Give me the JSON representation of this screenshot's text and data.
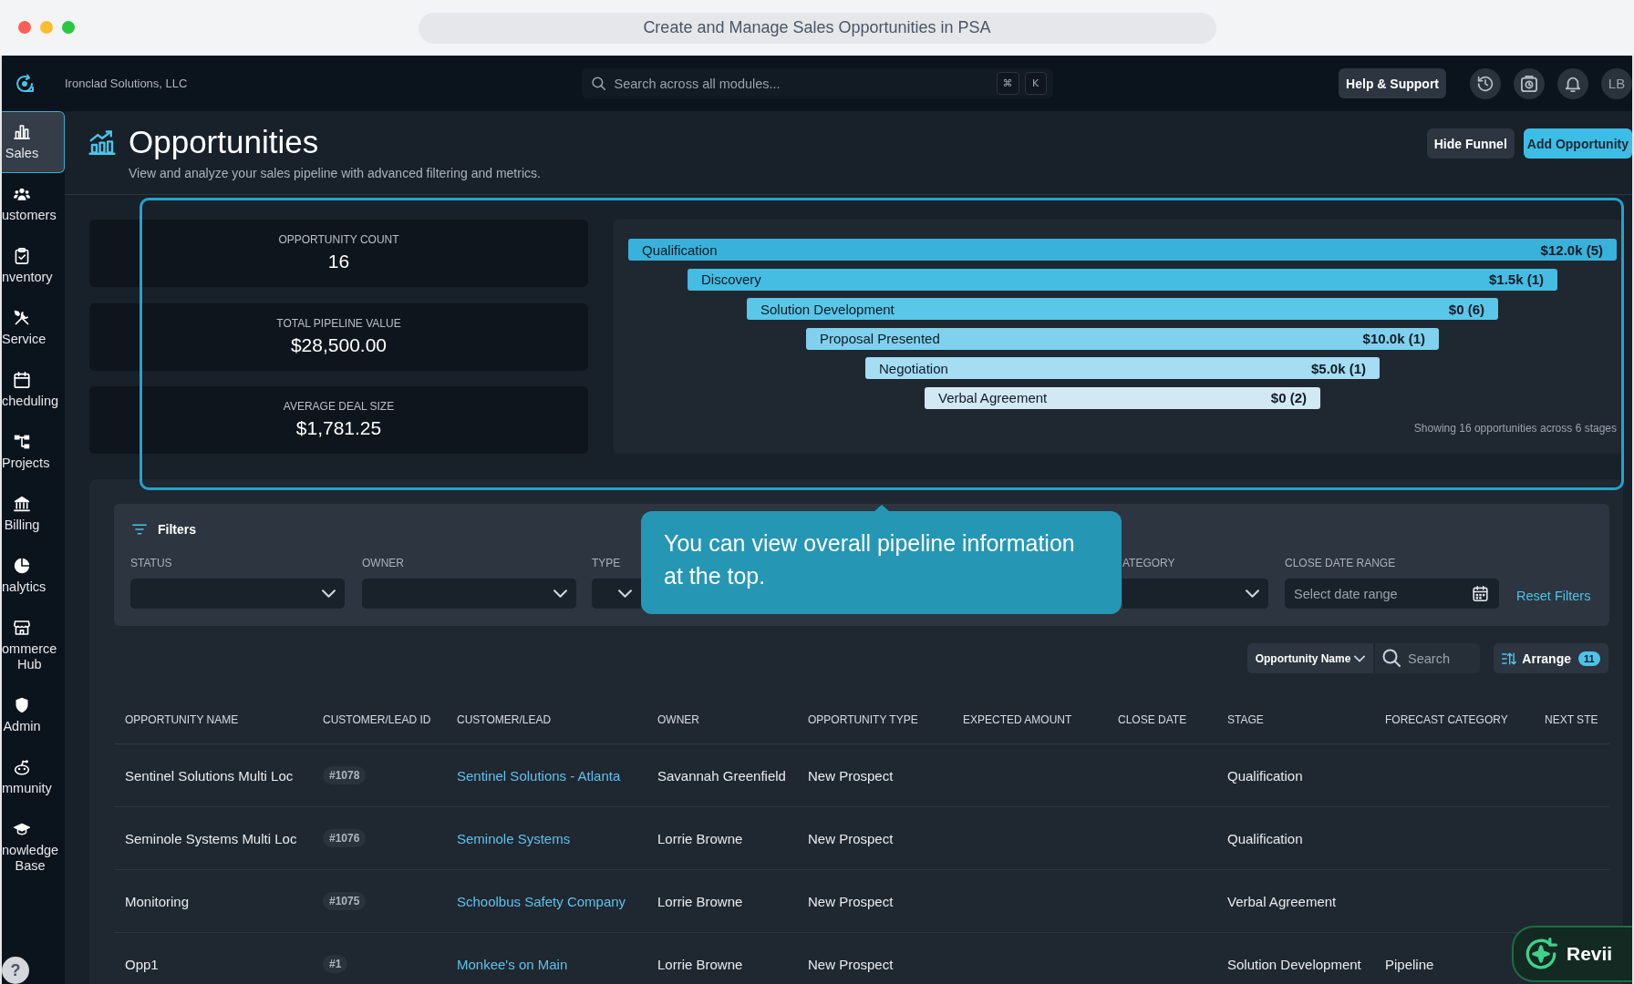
{
  "browser": {
    "title": "Create and Manage Sales Opportunities in PSA"
  },
  "topbar": {
    "company": "Ironclad Solutions, LLC",
    "search": {
      "placeholder": "Search across all modules...",
      "keys": [
        "⌘",
        "K"
      ]
    },
    "help_button": "Help & Support",
    "avatar": "LB"
  },
  "sidebar": {
    "items": [
      {
        "label": "Sales",
        "selected": true
      },
      {
        "label": "ustomers",
        "selected": false
      },
      {
        "label": "nventory",
        "selected": false
      },
      {
        "label": "Service",
        "selected": false
      },
      {
        "label": "cheduling",
        "selected": false
      },
      {
        "label": "Projects",
        "selected": false
      },
      {
        "label": "Billing",
        "selected": false
      },
      {
        "label": "nalytics",
        "selected": false
      },
      {
        "label": "ommerce Hub",
        "selected": false
      },
      {
        "label": "Admin",
        "selected": false
      },
      {
        "label": "mmunity",
        "selected": false
      },
      {
        "label": "nowledge Base",
        "selected": false
      }
    ],
    "help_button": "?"
  },
  "page": {
    "title": "Opportunities",
    "subtitle": "View and analyze your sales pipeline with advanced filtering and metrics.",
    "actions": [
      {
        "label": "Hide Funnel",
        "kind": "secondary"
      },
      {
        "label": "Add Opportunity",
        "kind": "primary"
      }
    ]
  },
  "stats": [
    {
      "label": "OPPORTUNITY COUNT",
      "value": "16"
    },
    {
      "label": "TOTAL PIPELINE VALUE",
      "value": "$28,500.00"
    },
    {
      "label": "AVERAGE DEAL SIZE",
      "value": "$1,781.25"
    }
  ],
  "funnel": {
    "stages": [
      {
        "name": "Qualification",
        "value": "$12.0k (5)",
        "color": "#38b2da"
      },
      {
        "name": "Discovery",
        "value": "$1.5k (1)",
        "color": "#45bce2"
      },
      {
        "name": "Solution Development",
        "value": "$0 (6)",
        "color": "#5ac6e8"
      },
      {
        "name": "Proposal Presented",
        "value": "$10.0k (1)",
        "color": "#7fd1ee"
      },
      {
        "name": "Negotiation",
        "value": "$5.0k (1)",
        "color": "#a5ddf2"
      },
      {
        "name": "Verbal Agreement",
        "value": "$0 (2)",
        "color": "#d2e9f3"
      }
    ],
    "note": "Showing 16 opportunities across 6 stages"
  },
  "filters": {
    "title": "Filters",
    "fields": [
      {
        "kind": "select",
        "label": "STATUS"
      },
      {
        "kind": "select",
        "label": "OWNER"
      },
      {
        "kind": "select",
        "label": "TYPE"
      },
      {
        "kind": "select",
        "label": "ATEGORY"
      },
      {
        "kind": "date",
        "label": "CLOSE DATE RANGE",
        "placeholder": "Select date range"
      }
    ],
    "reset": "Reset Filters"
  },
  "tour_tooltip": {
    "text": "You can view overall pipeline information at the top."
  },
  "toolbar": {
    "search_by": "Opportunity Name",
    "search": {
      "placeholder": "Search"
    },
    "arrange": {
      "label": "Arrange",
      "count": "11"
    }
  },
  "table": {
    "columns": [
      {
        "label": "OPPORTUNITY NAME",
        "kind": "text"
      },
      {
        "label": "CUSTOMER/LEAD ID",
        "kind": "id"
      },
      {
        "label": "CUSTOMER/LEAD",
        "kind": "link"
      },
      {
        "label": "OWNER",
        "kind": "text"
      },
      {
        "label": "OPPORTUNITY TYPE",
        "kind": "text"
      },
      {
        "label": "EXPECTED AMOUNT",
        "kind": "text"
      },
      {
        "label": "CLOSE DATE",
        "kind": "text"
      },
      {
        "label": "STAGE",
        "kind": "text"
      },
      {
        "label": "FORECAST CATEGORY",
        "kind": "text"
      },
      {
        "label": "NEXT STE",
        "kind": "text"
      }
    ],
    "rows": [
      {
        "opportunity_name": "Sentinel Solutions Multi Loc",
        "customer_lead_id": "#1078",
        "customer_lead": "Sentinel Solutions - Atlanta",
        "owner": "Savannah Greenfield",
        "opportunity_type": "New Prospect",
        "stage": "Qualification"
      },
      {
        "opportunity_name": "Seminole Systems Multi Loc",
        "customer_lead_id": "#1076",
        "customer_lead": "Seminole Systems",
        "owner": "Lorrie Browne",
        "opportunity_type": "New Prospect",
        "stage": "Qualification"
      },
      {
        "opportunity_name": "Monitoring",
        "customer_lead_id": "#1075",
        "customer_lead": "Schoolbus Safety Company",
        "owner": "Lorrie Browne",
        "opportunity_type": "New Prospect",
        "stage": "Verbal Agreement"
      },
      {
        "opportunity_name": "Opp1",
        "customer_lead_id": "#1",
        "customer_lead": "Monkee's on Main",
        "owner": "Lorrie Browne",
        "opportunity_type": "New Prospect",
        "stage": "Solution Development",
        "forecast_category": "Pipeline"
      }
    ]
  },
  "assistant": {
    "label": "Revii"
  }
}
